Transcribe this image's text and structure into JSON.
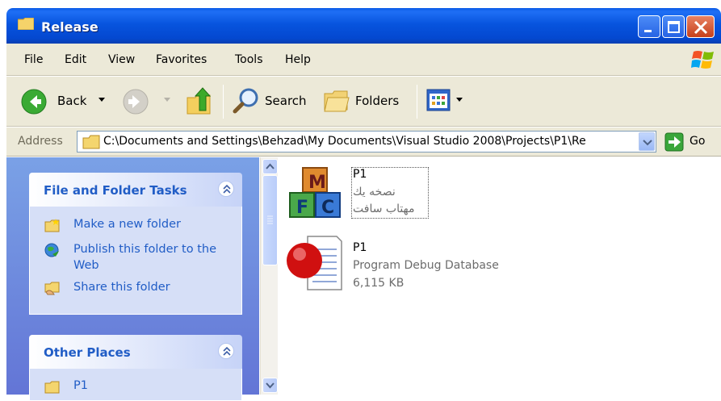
{
  "window": {
    "title": "Release"
  },
  "menu": [
    "File",
    "Edit",
    "View",
    "Favorites",
    "Tools",
    "Help"
  ],
  "toolbar": {
    "back_label": "Back",
    "search_label": "Search",
    "folders_label": "Folders"
  },
  "address": {
    "label": "Address",
    "value": "C:\\Documents and Settings\\Behzad\\My Documents\\Visual Studio 2008\\Projects\\P1\\Re",
    "go_label": "Go"
  },
  "tasks": {
    "file_folder": {
      "title": "File and Folder Tasks",
      "items": [
        "Make a new folder",
        "Publish this folder to the Web",
        "Share this folder"
      ]
    },
    "other_places": {
      "title": "Other Places",
      "items": [
        "P1"
      ]
    }
  },
  "files": [
    {
      "name": "P1",
      "line1": "نصخه يك",
      "line2": "مهتاب سافت",
      "icon": "mfc-app-icon"
    },
    {
      "name": "P1",
      "line1": "Program Debug Database",
      "line2": "6,115 KB",
      "icon": "pdb-file-icon"
    }
  ],
  "colors": {
    "title_blue": "#0754de",
    "link_blue": "#215dc6",
    "pane_blue": "#7aa1e6",
    "panel_bg": "#d6dff7"
  }
}
